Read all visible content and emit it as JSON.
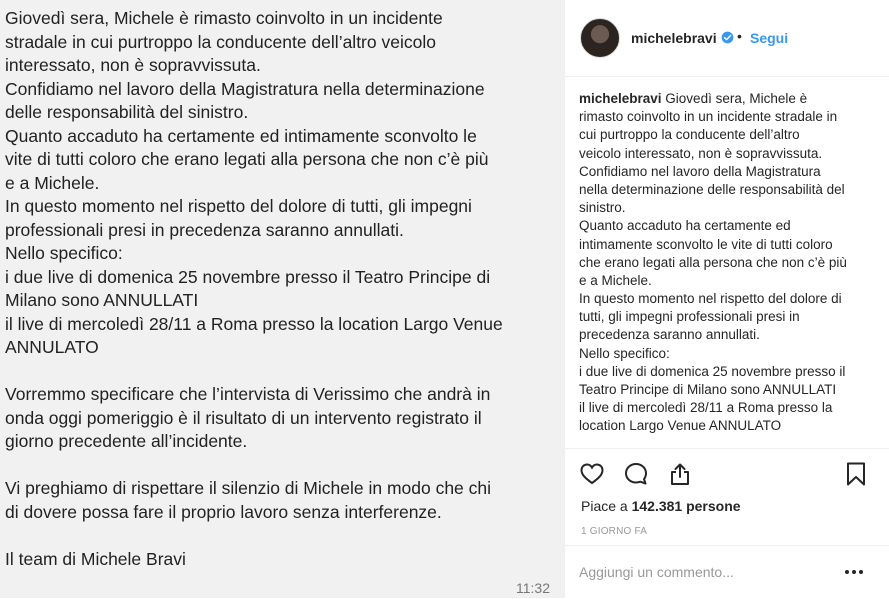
{
  "note": {
    "lines": [
      "Giovedì sera, Michele è rimasto coinvolto in un incidente",
      "stradale in cui purtroppo la conducente dell’altro veicolo",
      "interessato, non è sopravvissuta.",
      "Confidiamo nel lavoro della Magistratura nella determinazione",
      "delle responsabilità del sinistro.",
      "Quanto accaduto ha certamente ed intimamente sconvolto le",
      "vite di tutti coloro che erano legati alla persona che non c’è più",
      "e a Michele.",
      "In questo momento nel rispetto del dolore di tutti, gli impegni",
      "professionali presi in precedenza saranno annullati.",
      "Nello specifico:",
      "i due live di domenica 25 novembre presso il Teatro Principe di",
      "Milano sono ANNULLATI",
      "il live di mercoledì 28/11 a Roma presso la location Largo Venue",
      "ANNULATO",
      "",
      "Vorremmo specificare che l’intervista di Verissimo che andrà in",
      "onda oggi pomeriggio è il risultato di un intervento registrato il",
      "giorno precedente all’incidente.",
      "",
      "Vi preghiamo di rispettare il silenzio di Michele in modo che chi",
      "di dovere possa fare il proprio lavoro senza interferenze.",
      "",
      "Il team di Michele Bravi"
    ],
    "time": "11:32"
  },
  "post": {
    "username": "michelebravi",
    "separator": "•",
    "follow_label": "Segui",
    "caption_user": "michelebravi",
    "caption_lines": [
      " Giovedì sera, Michele è",
      "rimasto coinvolto in un incidente stradale in",
      "cui purtroppo la conducente dell’altro",
      "veicolo interessato, non è sopravvissuta.",
      "Confidiamo nel lavoro della Magistratura",
      "nella determinazione delle responsabilità del",
      "sinistro.",
      "Quanto accaduto ha certamente ed",
      "intimamente sconvolto le vite di tutti coloro",
      "che erano legati alla persona che non c’è più",
      "e a Michele.",
      "In questo momento nel rispetto del dolore di",
      "tutti, gli impegni professionali presi in",
      "precedenza saranno annullati.",
      "Nello specifico:",
      "i due live di domenica 25 novembre presso il",
      "Teatro Principe di Milano sono ANNULLATI",
      "il live di mercoledì 28/11 a Roma presso la",
      "location Largo Venue ANNULATO"
    ],
    "likes_prefix": "Piace a ",
    "likes_count": "142.381",
    "likes_suffix": " persone",
    "time_ago": "1 GIORNO FA",
    "comment_placeholder": "Aggiungi un commento...",
    "more_label": "•••"
  },
  "icons": {
    "verified": "verified-badge-icon",
    "like": "heart-icon",
    "comment": "comment-icon",
    "share": "share-icon",
    "save": "bookmark-icon",
    "more": "more-icon"
  },
  "colors": {
    "accent": "#3897f0",
    "note_bg": "#f1f1f1",
    "text": "#262626",
    "muted": "#999999"
  }
}
